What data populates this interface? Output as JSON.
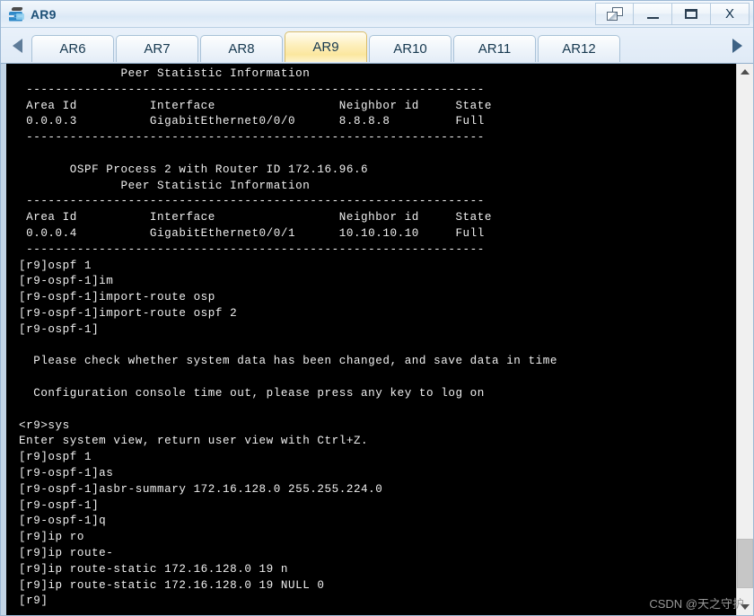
{
  "window": {
    "title": "AR9",
    "icon": "router-device-icon",
    "controls": [
      {
        "name": "restore-cascade-button",
        "label": "",
        "icon": "restore-window-icon"
      },
      {
        "name": "minimize-button",
        "label": "",
        "icon": "minimize-icon"
      },
      {
        "name": "maximize-button",
        "label": "",
        "icon": "maximize-icon"
      },
      {
        "name": "close-button",
        "label": "X",
        "icon": "close-icon"
      }
    ]
  },
  "tabbar": {
    "scroll_left_icon": "chevron-left-icon",
    "scroll_right_icon": "chevron-right-icon",
    "active_tab": "AR9",
    "tabs": [
      {
        "label": "AR6",
        "active": false
      },
      {
        "label": "AR7",
        "active": false
      },
      {
        "label": "AR8",
        "active": false
      },
      {
        "label": "AR9",
        "active": true
      },
      {
        "label": "AR10",
        "active": false
      },
      {
        "label": "AR11",
        "active": false
      },
      {
        "label": "AR12",
        "active": false
      }
    ]
  },
  "console": {
    "text_color": "#f0f0f0",
    "background_color": "#000000",
    "lines": [
      "              Peer Statistic Information",
      " ---------------------------------------------------------------",
      " Area Id          Interface                 Neighbor id     State",
      " 0.0.0.3          GigabitEthernet0/0/0      8.8.8.8         Full",
      " ---------------------------------------------------------------",
      "",
      "       OSPF Process 2 with Router ID 172.16.96.6",
      "              Peer Statistic Information",
      " ---------------------------------------------------------------",
      " Area Id          Interface                 Neighbor id     State",
      " 0.0.0.4          GigabitEthernet0/0/1      10.10.10.10     Full",
      " ---------------------------------------------------------------",
      "[r9]ospf 1",
      "[r9-ospf-1]im",
      "[r9-ospf-1]import-route osp",
      "[r9-ospf-1]import-route ospf 2",
      "[r9-ospf-1]",
      "",
      "  Please check whether system data has been changed, and save data in time",
      "",
      "  Configuration console time out, please press any key to log on",
      "",
      "<r9>sys",
      "Enter system view, return user view with Ctrl+Z.",
      "[r9]ospf 1",
      "[r9-ospf-1]as",
      "[r9-ospf-1]asbr-summary 172.16.128.0 255.255.224.0",
      "[r9-ospf-1]",
      "[r9-ospf-1]q",
      "[r9]ip ro",
      "[r9]ip route-",
      "[r9]ip route-static 172.16.128.0 19 n",
      "[r9]ip route-static 172.16.128.0 19 NULL 0",
      "[r9]"
    ]
  },
  "scrollbar": {
    "up_icon": "scroll-up-arrow-icon",
    "down_icon": "scroll-down-arrow-icon"
  },
  "watermark": {
    "text": "CSDN @天之守护"
  }
}
